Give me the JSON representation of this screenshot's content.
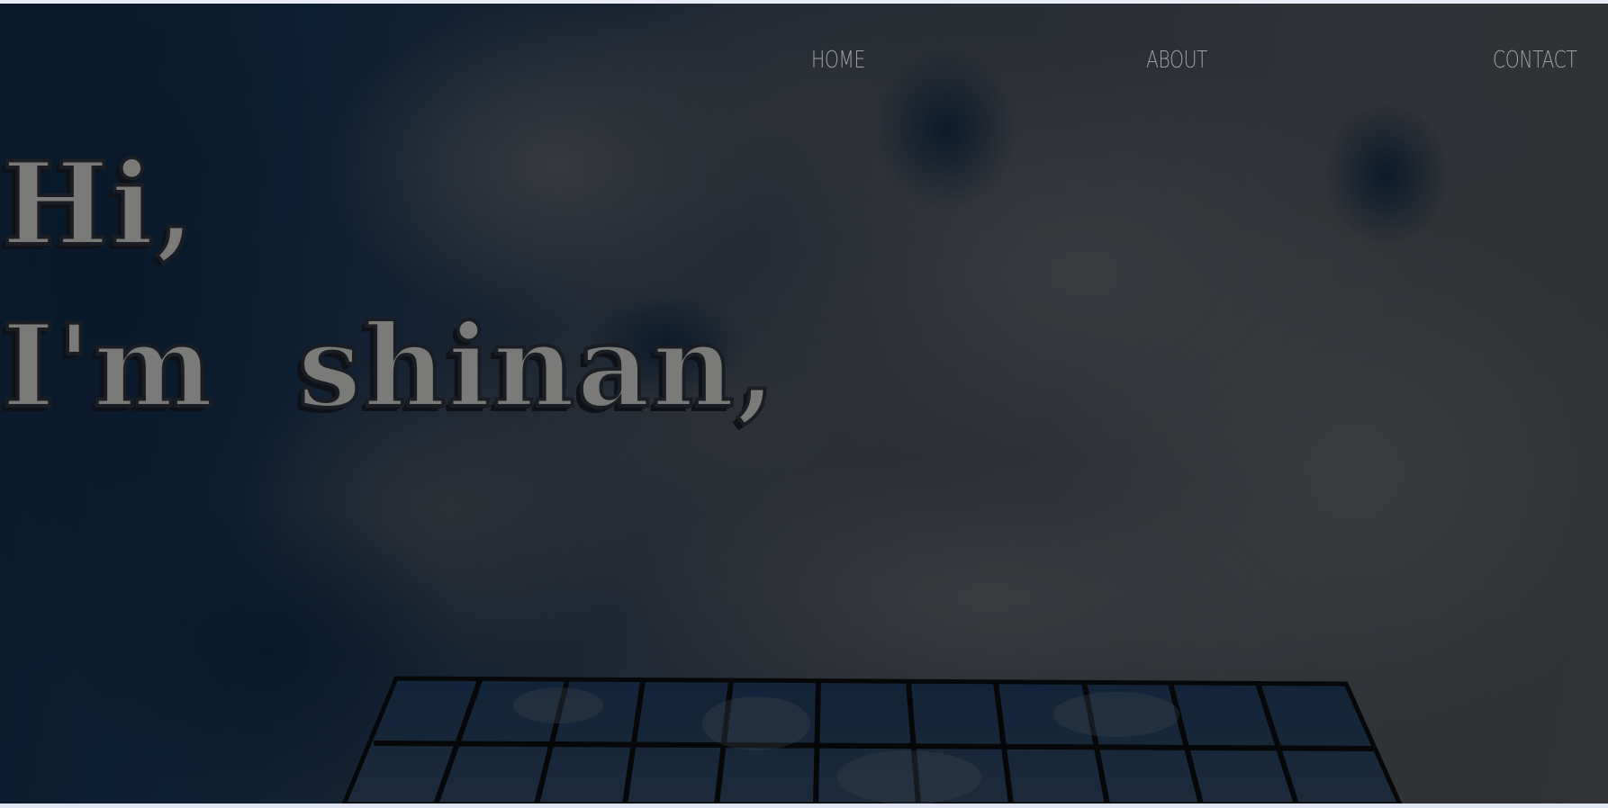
{
  "nav": {
    "home_label": "HOME",
    "about_label": "ABOUT",
    "contact_label": "CONTACT"
  },
  "hero": {
    "line1": "Hi,",
    "line2": "I'm  shinan,"
  },
  "colors": {
    "sky_dark": "#0a1a2d",
    "cloud_gray": "#313336",
    "heading_text": "#7a7b79",
    "nav_text": "#9fa2a6"
  },
  "icons": []
}
